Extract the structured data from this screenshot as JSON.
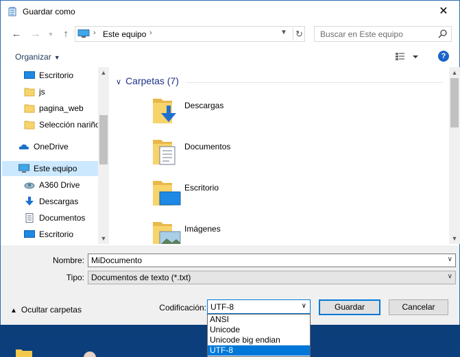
{
  "window": {
    "title": "Guardar como"
  },
  "address": {
    "location": "Este equipo"
  },
  "search": {
    "placeholder": "Buscar en Este equipo"
  },
  "toolbar": {
    "organize_label": "Organizar",
    "help_label": "?"
  },
  "nav_pane": {
    "items": [
      {
        "label": "Escritorio",
        "icon": "desktop-icon"
      },
      {
        "label": "js",
        "icon": "folder-icon"
      },
      {
        "label": "pagina_web",
        "icon": "folder-icon"
      },
      {
        "label": "Selección nariño",
        "icon": "folder-icon"
      },
      {
        "label": "OneDrive",
        "icon": "cloud-icon"
      },
      {
        "label": "Este equipo",
        "icon": "computer-icon",
        "selected": true
      },
      {
        "label": "A360 Drive",
        "icon": "a360-icon"
      },
      {
        "label": "Descargas",
        "icon": "download-icon"
      },
      {
        "label": "Documentos",
        "icon": "document-icon"
      },
      {
        "label": "Escritorio",
        "icon": "desktop-icon"
      }
    ]
  },
  "content": {
    "group_header": "Carpetas (7)",
    "folders": [
      {
        "label": "Descargas",
        "icon": "downloads-folder-icon"
      },
      {
        "label": "Documentos",
        "icon": "documents-folder-icon"
      },
      {
        "label": "Escritorio",
        "icon": "desktop-folder-icon"
      },
      {
        "label": "Imágenes",
        "icon": "pictures-folder-icon"
      }
    ]
  },
  "form": {
    "name_label": "Nombre:",
    "name_value": "MiDocumento",
    "type_label": "Tipo:",
    "type_value": "Documentos de texto (*.txt)",
    "encoding_label": "Codificación:",
    "encoding_value": "UTF-8",
    "encoding_options": [
      "ANSI",
      "Unicode",
      "Unicode big endian",
      "UTF-8"
    ],
    "save_label": "Guardar",
    "cancel_label": "Cancelar",
    "hide_folders_label": "Ocultar carpetas"
  },
  "colors": {
    "accent": "#0078d7",
    "selection": "#cce8ff",
    "group_header": "#1e3287",
    "dialog_bg": "#f0f0f0"
  }
}
